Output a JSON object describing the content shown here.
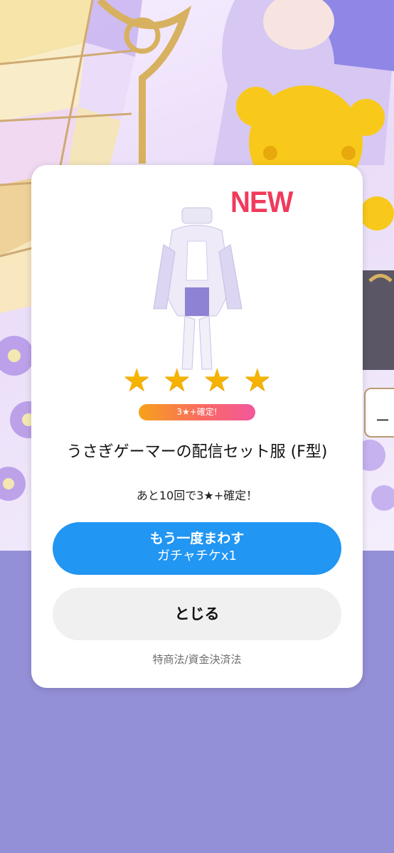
{
  "dialog": {
    "new_badge": "NEW",
    "rarity_stars": 4,
    "stars": [
      "★",
      "★",
      "★",
      "★"
    ],
    "guarantee_badge": "3★+確定!",
    "item_name": "うさぎゲーマーの配信セット服 (F型)",
    "remaining_text": "あと10回で3★+確定！",
    "spin_again_button": {
      "line1": "もう一度まわす",
      "line2": "ガチャチケx1"
    },
    "close_button": "とじる",
    "legal_link": "特商法/資金決済法"
  },
  "background": {
    "speech_bubble_text": "ー"
  },
  "colors": {
    "primary_button": "#2196f3",
    "star": "#f5b300",
    "new_badge": "#f03a5c",
    "lower_background": "#9490d8"
  }
}
